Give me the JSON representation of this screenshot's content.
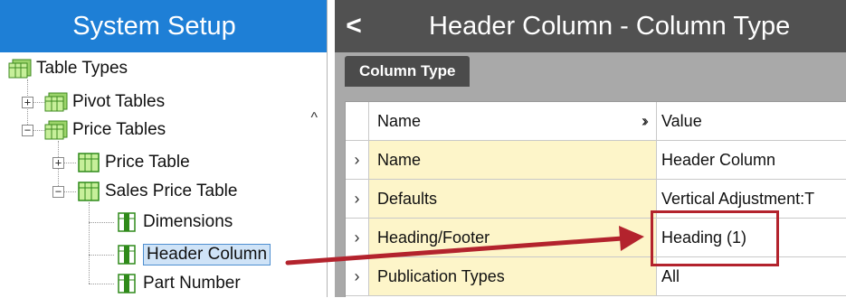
{
  "left": {
    "title": "System Setup",
    "tree": {
      "root": "Table Types",
      "pivot": "Pivot Tables",
      "price": "Price Tables",
      "price_table": "Price Table",
      "sales_price_table": "Sales Price Table",
      "dimensions": "Dimensions",
      "header_column": "Header Column",
      "part_number": "Part Number"
    },
    "scroll_up": "^"
  },
  "right": {
    "title": "Header Column - Column Type",
    "back": "<",
    "tab": "Column Type",
    "grid": {
      "header": {
        "name": "Name",
        "value": "Value"
      },
      "rows": [
        {
          "name": "Name",
          "value": "Header Column"
        },
        {
          "name": "Defaults",
          "value": "Vertical Adjustment:T"
        },
        {
          "name": "Heading/Footer",
          "value": "Heading (1)"
        },
        {
          "name": "Publication Types",
          "value": "All"
        }
      ]
    }
  },
  "colors": {
    "left_header": "#1e7fd6",
    "right_header": "#515151",
    "name_cell": "#fdf5c9",
    "highlight": "#b3232d"
  }
}
